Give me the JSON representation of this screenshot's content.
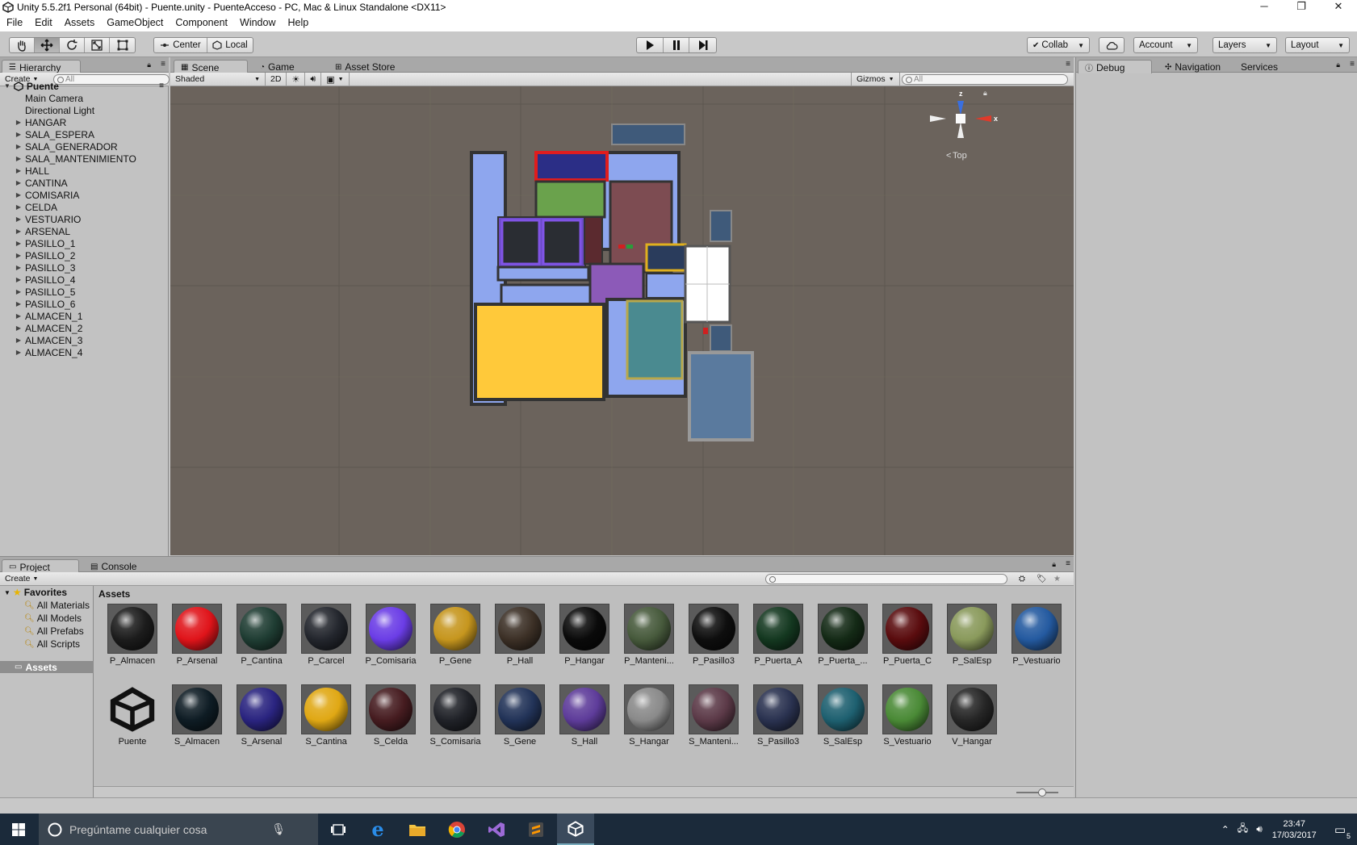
{
  "window": {
    "title": "Unity 5.5.2f1 Personal (64bit) - Puente.unity - PuenteAcceso - PC, Mac & Linux Standalone <DX11>",
    "minimize": "─",
    "restore": "❐",
    "close": "✕"
  },
  "menu": [
    "File",
    "Edit",
    "Assets",
    "GameObject",
    "Component",
    "Window",
    "Help"
  ],
  "toolbar": {
    "pivot": "Center",
    "space": "Local",
    "collab": "Collab",
    "account": "Account",
    "layers": "Layers",
    "layout": "Layout"
  },
  "hierarchy": {
    "tab": "Hierarchy",
    "create": "Create",
    "search_placeholder": "All",
    "scene_name": "Puente",
    "items": [
      {
        "label": "Main Camera",
        "expandable": false
      },
      {
        "label": "Directional Light",
        "expandable": false
      },
      {
        "label": "HANGAR",
        "expandable": true
      },
      {
        "label": "SALA_ESPERA",
        "expandable": true
      },
      {
        "label": "SALA_GENERADOR",
        "expandable": true
      },
      {
        "label": "SALA_MANTENIMIENTO",
        "expandable": true
      },
      {
        "label": "HALL",
        "expandable": true
      },
      {
        "label": "CANTINA",
        "expandable": true
      },
      {
        "label": "COMISARIA",
        "expandable": true
      },
      {
        "label": "CELDA",
        "expandable": true
      },
      {
        "label": "VESTUARIO",
        "expandable": true
      },
      {
        "label": "ARSENAL",
        "expandable": true
      },
      {
        "label": "PASILLO_1",
        "expandable": true
      },
      {
        "label": "PASILLO_2",
        "expandable": true
      },
      {
        "label": "PASILLO_3",
        "expandable": true
      },
      {
        "label": "PASILLO_4",
        "expandable": true
      },
      {
        "label": "PASILLO_5",
        "expandable": true
      },
      {
        "label": "PASILLO_6",
        "expandable": true
      },
      {
        "label": "ALMACEN_1",
        "expandable": true
      },
      {
        "label": "ALMACEN_2",
        "expandable": true
      },
      {
        "label": "ALMACEN_3",
        "expandable": true
      },
      {
        "label": "ALMACEN_4",
        "expandable": true
      }
    ]
  },
  "scene": {
    "tabs": [
      "Scene",
      "Game",
      "Asset Store"
    ],
    "shading": "Shaded",
    "mode2d": "2D",
    "gizmos": "Gizmos",
    "search_placeholder": "All",
    "gizmo_view": "Top",
    "axis_z": "z",
    "axis_x": "x"
  },
  "right_pane": {
    "tabs": [
      "Debug",
      "Navigation",
      "Services"
    ]
  },
  "project": {
    "tabs": [
      "Project",
      "Console"
    ],
    "create": "Create",
    "favorites_label": "Favorites",
    "favorites": [
      "All Materials",
      "All Models",
      "All Prefabs",
      "All Scripts"
    ],
    "assets_folder": "Assets",
    "breadcrumb": "Assets",
    "assets": [
      {
        "name": "P_Almacen",
        "color": "#1c1c1c"
      },
      {
        "name": "P_Arsenal",
        "color": "#e0141a"
      },
      {
        "name": "P_Cantina",
        "color": "#1f3d33"
      },
      {
        "name": "P_Carcel",
        "color": "#23262d"
      },
      {
        "name": "P_Comisaria",
        "color": "#6b3de6"
      },
      {
        "name": "P_Gene",
        "color": "#c6961e"
      },
      {
        "name": "P_Hall",
        "color": "#3c3026"
      },
      {
        "name": "P_Hangar",
        "color": "#0a0a0a"
      },
      {
        "name": "P_Manteni...",
        "color": "#475a3c"
      },
      {
        "name": "P_Pasillo3",
        "color": "#0e0e0e"
      },
      {
        "name": "P_Puerta_A",
        "color": "#143820"
      },
      {
        "name": "P_Puerta_...",
        "color": "#142a16"
      },
      {
        "name": "P_Puerta_C",
        "color": "#5a0c0e"
      },
      {
        "name": "P_SalEsp",
        "color": "#8a9a5c"
      },
      {
        "name": "P_Vestuario",
        "color": "#245aa0"
      },
      {
        "name": "Puente",
        "color": "unity"
      },
      {
        "name": "S_Almacen",
        "color": "#0e1c24"
      },
      {
        "name": "S_Arsenal",
        "color": "#2a2480"
      },
      {
        "name": "S_Cantina",
        "color": "#e0a814"
      },
      {
        "name": "S_Celda",
        "color": "#461c20"
      },
      {
        "name": "S_Comisaria",
        "color": "#202228"
      },
      {
        "name": "S_Gene",
        "color": "#223358"
      },
      {
        "name": "S_Hall",
        "color": "#5e3c9a"
      },
      {
        "name": "S_Hangar",
        "color": "#8a8a8a"
      },
      {
        "name": "S_Manteni...",
        "color": "#5c3a48"
      },
      {
        "name": "S_Pasillo3",
        "color": "#2a3250"
      },
      {
        "name": "S_SalEsp",
        "color": "#1e6070"
      },
      {
        "name": "S_Vestuario",
        "color": "#4a8a36"
      },
      {
        "name": "V_Hangar",
        "color": "#262626"
      }
    ]
  },
  "taskbar": {
    "search_placeholder": "Pregúntame cualquier cosa",
    "time": "23:47",
    "date": "17/03/2017",
    "notifications": "5"
  }
}
